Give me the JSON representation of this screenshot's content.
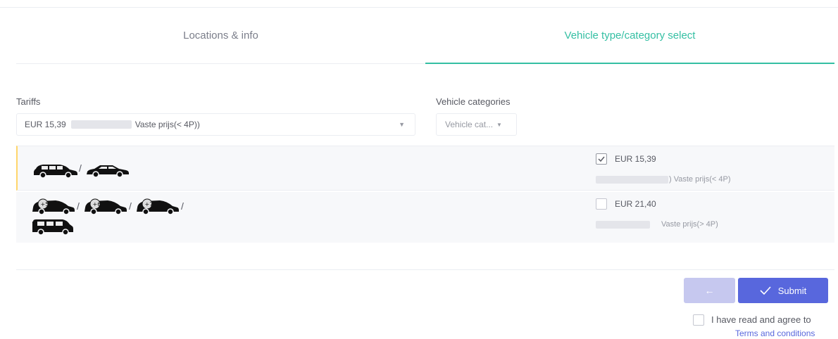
{
  "tabs": [
    {
      "label": "Locations & info",
      "active": false
    },
    {
      "label": "Vehicle type/category select",
      "active": true
    }
  ],
  "tariffs": {
    "label": "Tariffs",
    "selected_prefix": "EUR 15,39",
    "selected_suffix": "Vaste prijs(< 4P))"
  },
  "vehicle_categories": {
    "label": "Vehicle categories",
    "placeholder": "Vehicle cat..."
  },
  "rows": [
    {
      "icons": [
        "minivan-icon",
        "sedan-icon"
      ],
      "checked": true,
      "price": "EUR 15,39",
      "tariff_name": ") Vaste prijs(< 4P)"
    },
    {
      "icons": [
        "5-seat-car-icon",
        "6-seat-car-icon",
        "7-seat-car-icon",
        "van-icon"
      ],
      "checked": false,
      "price": "EUR 21,40",
      "tariff_name": "Vaste prijs(> 4P)"
    }
  ],
  "actions": {
    "back_label": "←",
    "submit_label": "Submit",
    "agree_label": "I have read and agree to",
    "terms_label": "Terms and conditions"
  },
  "colors": {
    "accent_teal": "#34bfa3",
    "primary": "#5867dd",
    "row_highlight": "#ffd66b"
  }
}
